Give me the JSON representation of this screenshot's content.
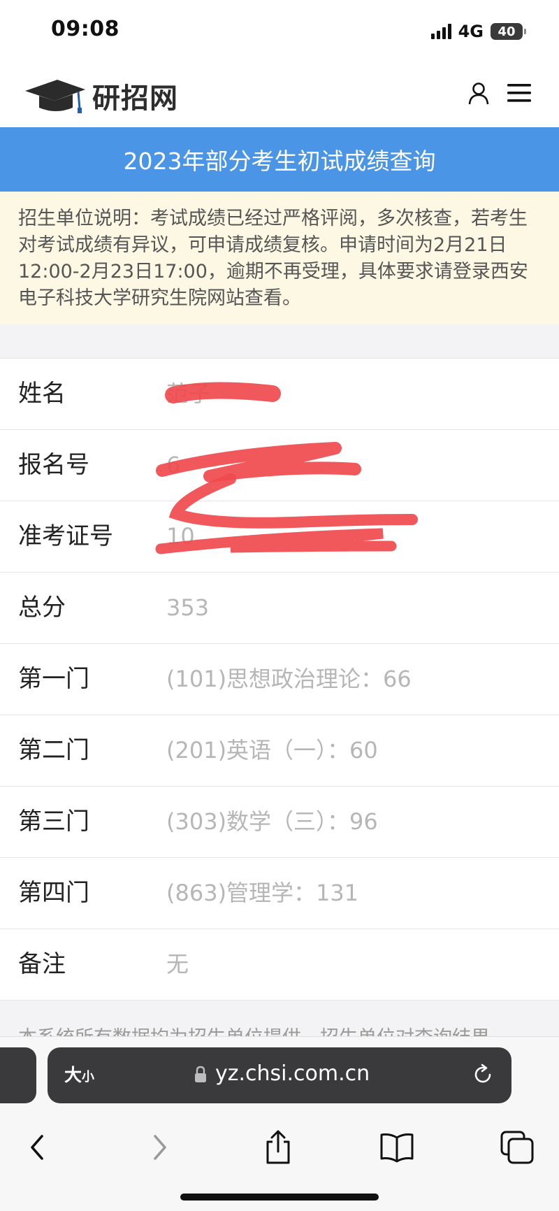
{
  "status_bar": {
    "time": "09:08",
    "network": "4G",
    "battery_level": "40"
  },
  "header": {
    "logo_text": "研招网",
    "icons": [
      "graduation-cap-icon",
      "user-icon",
      "menu-icon"
    ]
  },
  "banner": {
    "title": "2023年部分考生初试成绩查询",
    "color": "#4a95e6"
  },
  "notice": {
    "text": "招生单位说明：考试成绩已经过严格评阅，多次核查，若考生对考试成绩有异议，可申请成绩复核。申请时间为2月21日12:00-2月23日17:00，逾期不再受理，具体要求请登录西安电子科技大学研究生院网站查看。"
  },
  "score_table": {
    "rows": [
      {
        "label": "姓名",
        "value": "范子"
      },
      {
        "label": "报名号",
        "value": "6"
      },
      {
        "label": "准考证号",
        "value": "10"
      },
      {
        "label": "总分",
        "value": "353"
      },
      {
        "label": "第一门",
        "value": "(101)思想政治理论：66"
      },
      {
        "label": "第二门",
        "value": "(201)英语（一）：60"
      },
      {
        "label": "第三门",
        "value": "(303)数学（三）：96"
      },
      {
        "label": "第四门",
        "value": "(863)管理学：131"
      },
      {
        "label": "备注",
        "value": "无"
      }
    ]
  },
  "footer": {
    "note": "本系统所有数据均为招生单位提供，招生单位对查询结果"
  },
  "browser": {
    "text_size_label": "大",
    "text_size_small": "小",
    "url": "yz.chsi.com.cn",
    "nav_icons": [
      "back-icon",
      "forward-icon",
      "share-icon",
      "bookmarks-icon",
      "tabs-icon"
    ]
  },
  "colors": {
    "redaction": "#f04a4e",
    "notice_bg": "#fdf8e4"
  }
}
